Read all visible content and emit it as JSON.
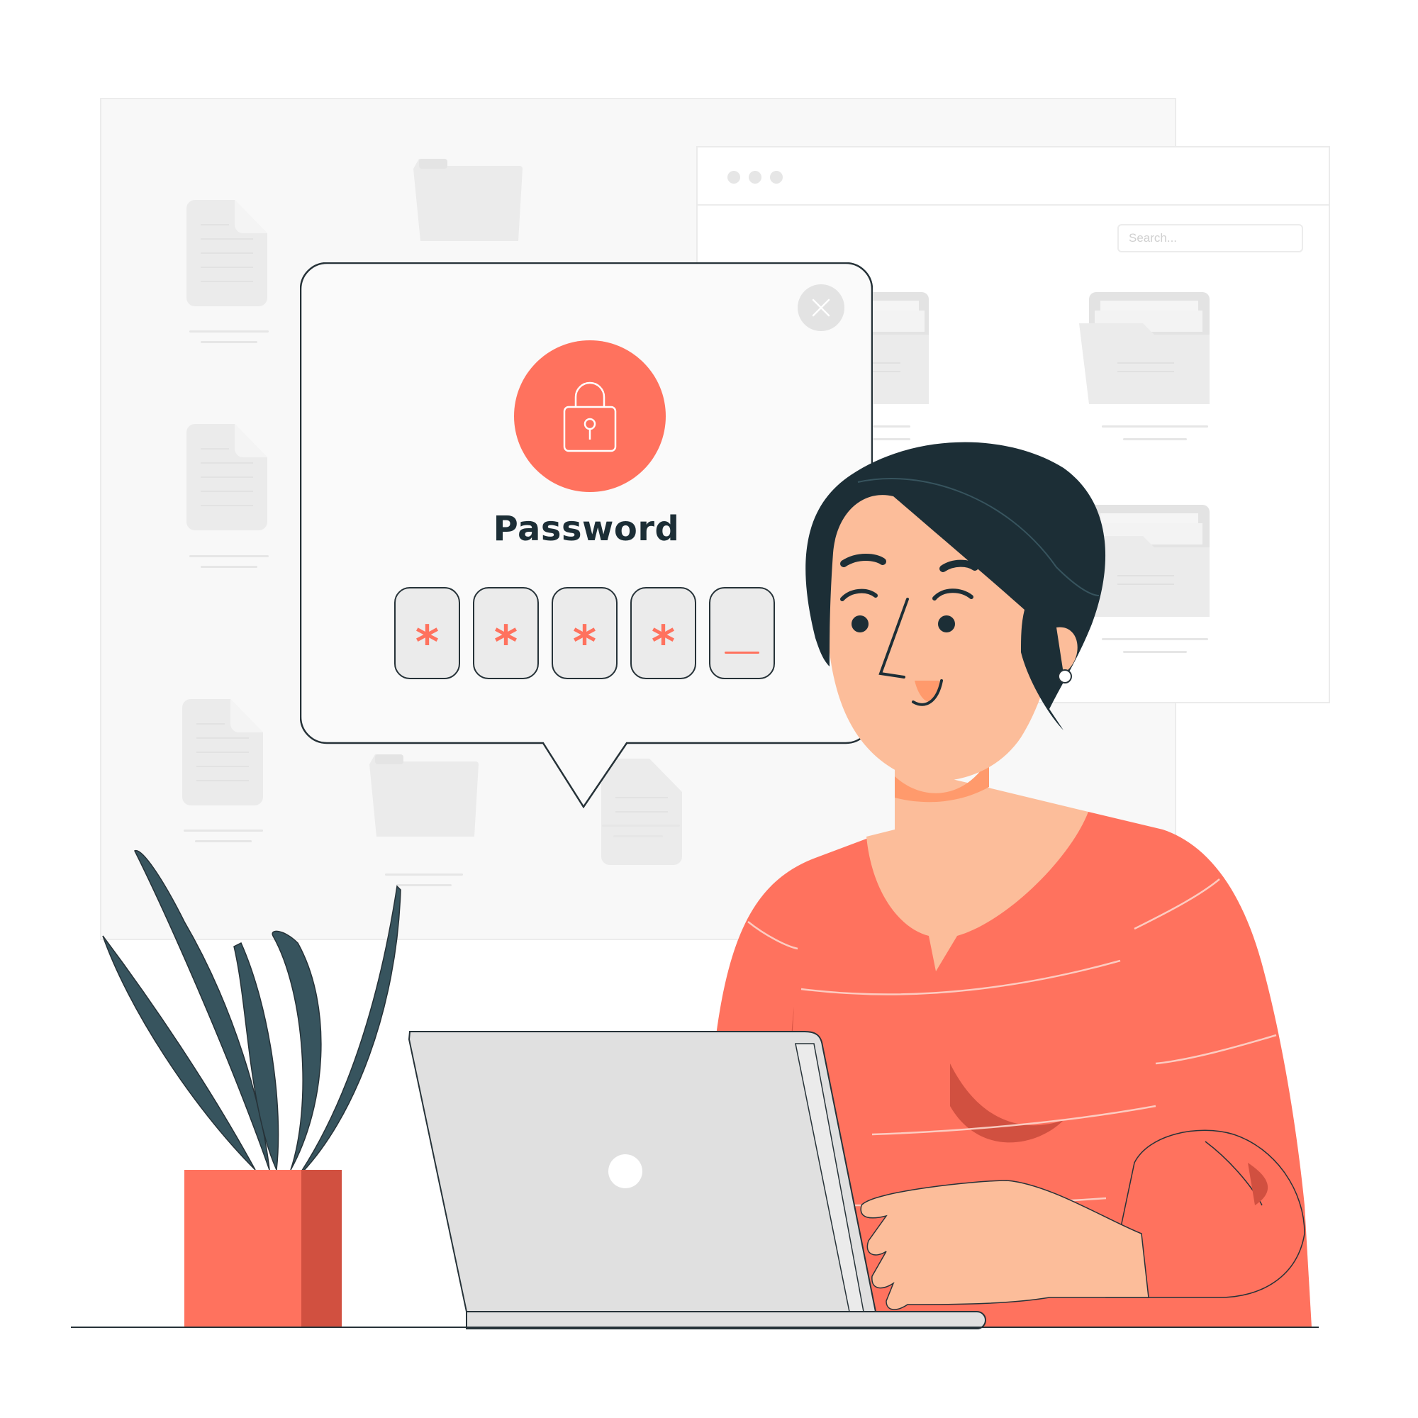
{
  "dialog": {
    "title": "Password",
    "close_icon": "close-icon",
    "lock_icon": "padlock-icon",
    "pin_slots": [
      {
        "value": "*",
        "filled": true
      },
      {
        "value": "*",
        "filled": true
      },
      {
        "value": "*",
        "filled": true
      },
      {
        "value": "*",
        "filled": true
      },
      {
        "value": "",
        "filled": false,
        "cursor": true
      }
    ]
  },
  "browser_window": {
    "window_controls": [
      "dot",
      "dot",
      "dot"
    ],
    "search": {
      "value": "",
      "placeholder": "Search..."
    },
    "items": [
      "folder",
      "folder",
      "folder"
    ]
  },
  "back_panel": {
    "items": [
      "document",
      "folder",
      "document",
      "document",
      "folder",
      "document"
    ]
  },
  "illustration": {
    "person": "woman-typing-on-laptop",
    "plant": "potted-plant",
    "laptop": "laptop"
  },
  "colors": {
    "accent": "#ff725e",
    "accent_dark": "#d15040",
    "ink": "#263238",
    "hair": "#1c2e36",
    "skin": "#fcbd9a",
    "plant": "#37545e",
    "laptop": "#e0e0e0",
    "panel": "#f8f8f8",
    "icon_gray": "#ebebeb"
  }
}
